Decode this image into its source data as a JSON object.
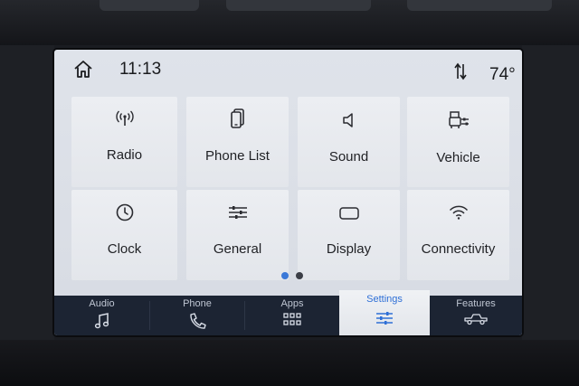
{
  "status": {
    "time": "11:13",
    "temperature": "74°"
  },
  "tiles": [
    {
      "label": "Radio",
      "icon": "radio-antenna-icon"
    },
    {
      "label": "Phone List",
      "icon": "phone-list-icon"
    },
    {
      "label": "Sound",
      "icon": "speaker-icon"
    },
    {
      "label": "Vehicle",
      "icon": "vehicle-settings-icon"
    },
    {
      "label": "Clock",
      "icon": "clock-icon"
    },
    {
      "label": "General",
      "icon": "sliders-icon"
    },
    {
      "label": "Display",
      "icon": "display-icon"
    },
    {
      "label": "Connectivity",
      "icon": "wifi-icon"
    }
  ],
  "pagination": {
    "pages": 2,
    "current": 1,
    "active_color": "#3a78d8",
    "inactive_color": "#3b3e46"
  },
  "nav": [
    {
      "label": "Audio",
      "icon": "music-note-icon"
    },
    {
      "label": "Phone",
      "icon": "phone-handset-icon"
    },
    {
      "label": "Apps",
      "icon": "apps-grid-icon"
    },
    {
      "label": "Settings",
      "icon": "settings-sliders-icon",
      "active": true
    },
    {
      "label": "Features",
      "icon": "truck-icon"
    }
  ],
  "colors": {
    "accent": "#2e6fd6",
    "navbar": "#1c2433",
    "screen": "#dfe3ea"
  }
}
